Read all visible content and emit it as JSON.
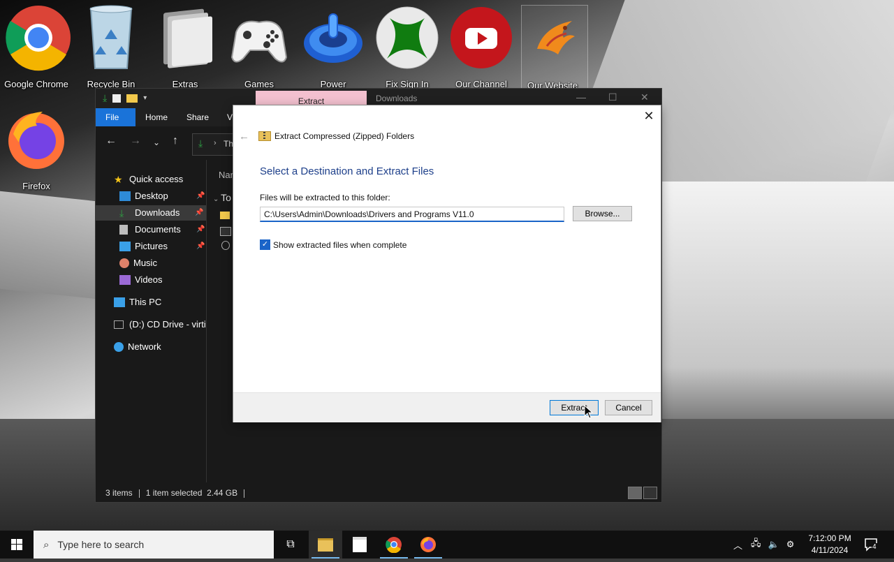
{
  "desktop": {
    "icons": [
      {
        "label": "Google Chrome"
      },
      {
        "label": "Recycle Bin"
      },
      {
        "label": "Extras"
      },
      {
        "label": "Games"
      },
      {
        "label": "Power"
      },
      {
        "label": "Fix Sign In"
      },
      {
        "label": "Our Channel"
      },
      {
        "label": "Our Website"
      },
      {
        "label": "Firefox"
      }
    ]
  },
  "explorer": {
    "context_tab": "Extract",
    "title": "Downloads",
    "ribbon_tabs": [
      "File",
      "Home",
      "Share",
      "Vi"
    ],
    "address_fragment": "Th",
    "content_header": "Nar",
    "content_group": "To",
    "sidebar": [
      {
        "label": "Quick access"
      },
      {
        "label": "Desktop"
      },
      {
        "label": "Downloads"
      },
      {
        "label": "Documents"
      },
      {
        "label": "Pictures"
      },
      {
        "label": "Music"
      },
      {
        "label": "Videos"
      },
      {
        "label": "This PC"
      },
      {
        "label": "(D:) CD Drive - virti"
      },
      {
        "label": "Network"
      }
    ],
    "status": {
      "items": "3 items",
      "selected": "1 item selected",
      "size": "2.44 GB"
    }
  },
  "dialog": {
    "header": "Extract Compressed (Zipped) Folders",
    "heading": "Select a Destination and Extract Files",
    "folder_label": "Files will be extracted to this folder:",
    "path_value": "C:\\Users\\Admin\\Downloads\\Drivers and Programs V11.0",
    "browse_label": "Browse...",
    "checkbox_label": "Show extracted files when complete",
    "checkbox_checked": true,
    "extract_label": "Extract",
    "cancel_label": "Cancel"
  },
  "taskbar": {
    "search_placeholder": "Type here to search",
    "time": "7:12:00 PM",
    "date": "4/11/2024",
    "notification_count": "4"
  },
  "colors": {
    "accent": "#1a64c8",
    "file_tab": "#1a73d9",
    "context_tab": "#f3c0cf",
    "heading": "#1d3f8a"
  }
}
